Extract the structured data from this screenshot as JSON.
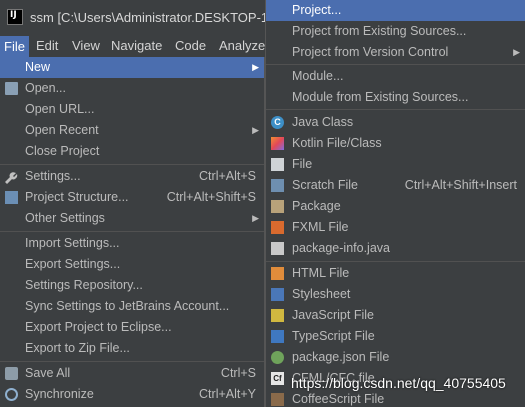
{
  "window": {
    "title": "ssm [C:\\Users\\Administrator.DESKTOP-19"
  },
  "menubar": [
    "File",
    "Edit",
    "View",
    "Navigate",
    "Code",
    "Analyze"
  ],
  "file_menu": {
    "new": "New",
    "open": "Open...",
    "open_url": "Open URL...",
    "open_recent": "Open Recent",
    "close_project": "Close Project",
    "settings": "Settings...",
    "settings_sc": "Ctrl+Alt+S",
    "project_structure": "Project Structure...",
    "project_structure_sc": "Ctrl+Alt+Shift+S",
    "other_settings": "Other Settings",
    "import_settings": "Import Settings...",
    "export_settings": "Export Settings...",
    "settings_repository": "Settings Repository...",
    "sync_settings": "Sync Settings to JetBrains Account...",
    "export_eclipse": "Export Project to Eclipse...",
    "export_zip": "Export to Zip File...",
    "save_all": "Save All",
    "save_all_sc": "Ctrl+S",
    "synchronize": "Synchronize",
    "synchronize_sc": "Ctrl+Alt+Y"
  },
  "new_submenu": {
    "project": "Project...",
    "project_existing": "Project from Existing Sources...",
    "project_vcs": "Project from Version Control",
    "module": "Module...",
    "module_existing": "Module from Existing Sources...",
    "java_class": "Java Class",
    "kotlin": "Kotlin File/Class",
    "file": "File",
    "scratch": "Scratch File",
    "scratch_sc": "Ctrl+Alt+Shift+Insert",
    "package": "Package",
    "fxml": "FXML File",
    "package_info": "package-info.java",
    "html": "HTML File",
    "stylesheet": "Stylesheet",
    "javascript": "JavaScript File",
    "typescript": "TypeScript File",
    "package_json": "package.json File",
    "cfml": "CFML/CFC file",
    "coffeescript": "CoffeeScript File"
  },
  "watermark": "https://blog.csdn.net/qq_40755405",
  "colors": {
    "background": "#3c3f41",
    "highlight": "#4b6eaf",
    "text": "#bbbbbb"
  }
}
